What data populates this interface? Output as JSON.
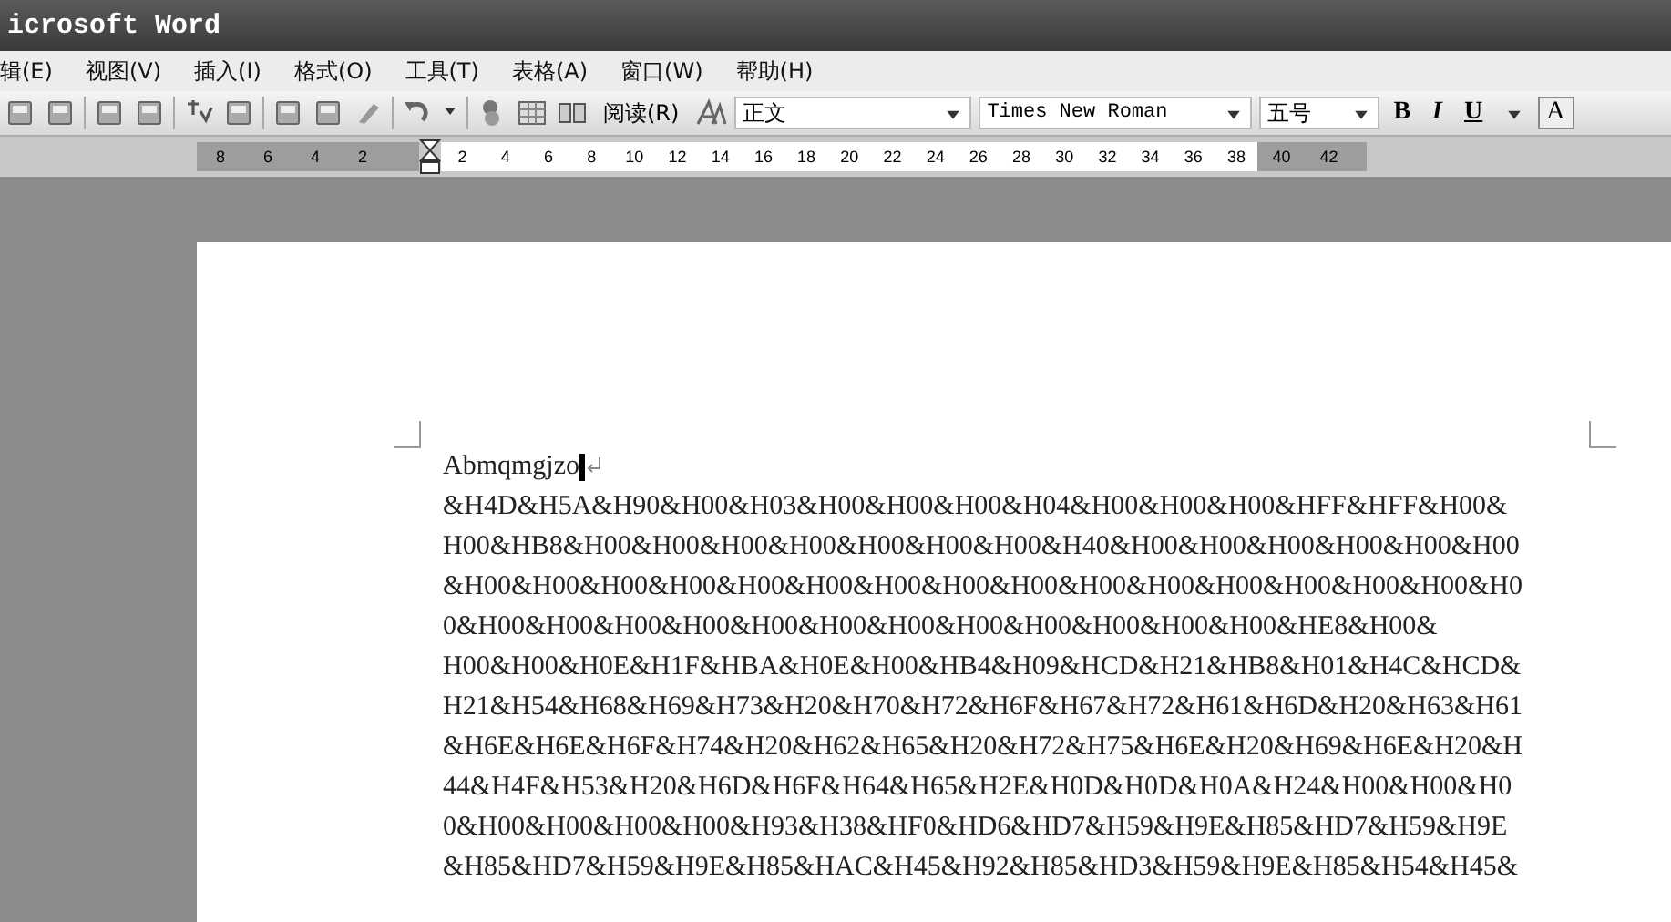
{
  "window": {
    "title": "icrosoft Word"
  },
  "menu": [
    "辑(E)",
    "视图(V)",
    "插入(I)",
    "格式(O)",
    "工具(T)",
    "表格(A)",
    "窗口(W)",
    "帮助(H)"
  ],
  "toolbar": {
    "read_button": "阅读(R)",
    "style": "正文",
    "font": "Times New Roman",
    "size": "五号",
    "bold": "B",
    "italic": "I",
    "underline": "U",
    "font_color": "A"
  },
  "ruler": {
    "left_numbers": [
      "8",
      "6",
      "4",
      "2"
    ],
    "numbers": [
      "2",
      "4",
      "6",
      "8",
      "10",
      "12",
      "14",
      "16",
      "18",
      "20",
      "22",
      "24",
      "26",
      "28",
      "30",
      "32",
      "34",
      "36",
      "38"
    ],
    "right_numbers": [
      "40",
      "42"
    ]
  },
  "document": {
    "first_line": "Abmqmgjzo",
    "lines": [
      "&H4D&H5A&H90&H00&H03&H00&H00&H00&H04&H00&H00&H00&HFF&HFF&H00&",
      "H00&HB8&H00&H00&H00&H00&H00&H00&H00&H40&H00&H00&H00&H00&H00&H00",
      "&H00&H00&H00&H00&H00&H00&H00&H00&H00&H00&H00&H00&H00&H00&H00&H0",
      "0&H00&H00&H00&H00&H00&H00&H00&H00&H00&H00&H00&H00&HE8&H00&",
      "H00&H00&H0E&H1F&HBA&H0E&H00&HB4&H09&HCD&H21&HB8&H01&H4C&HCD&",
      "H21&H54&H68&H69&H73&H20&H70&H72&H6F&H67&H72&H61&H6D&H20&H63&H61",
      "&H6E&H6E&H6F&H74&H20&H62&H65&H20&H72&H75&H6E&H20&H69&H6E&H20&H",
      "44&H4F&H53&H20&H6D&H6F&H64&H65&H2E&H0D&H0D&H0A&H24&H00&H00&H0",
      "0&H00&H00&H00&H00&H93&H38&HF0&HD6&HD7&H59&H9E&H85&HD7&H59&H9E",
      "&H85&HD7&H59&H9E&H85&HAC&H45&H92&H85&HD3&H59&H9E&H85&H54&H45&"
    ]
  }
}
